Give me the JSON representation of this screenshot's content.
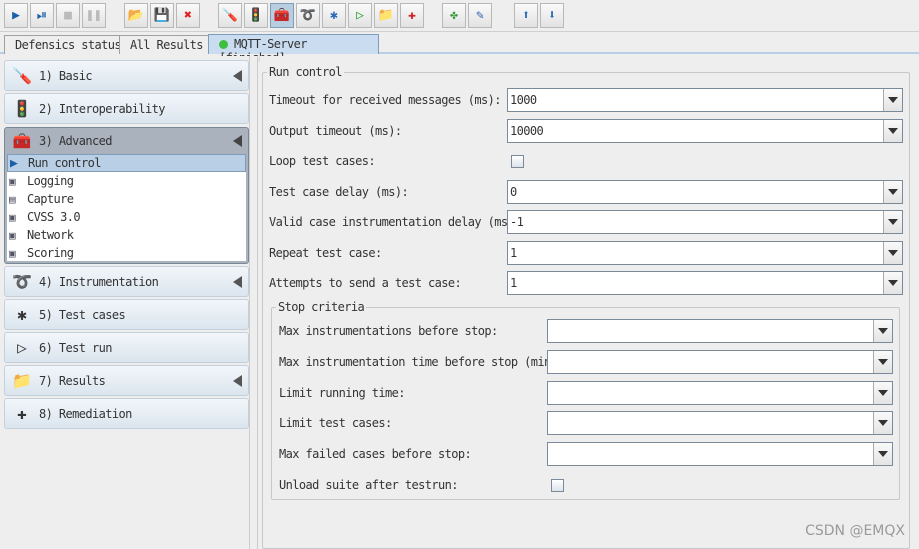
{
  "toolbar": {
    "buttons": [
      {
        "icon": "play-icon",
        "glyph": "▶",
        "color": "#1a5fa8"
      },
      {
        "icon": "play-step-icon",
        "glyph": "⏯",
        "color": "#1a5fa8"
      },
      {
        "icon": "stop-icon",
        "glyph": "■",
        "color": "#bbbbbb"
      },
      {
        "icon": "pause-icon",
        "glyph": "❚❚",
        "color": "#bbbbbb"
      },
      {
        "icon": "open-suite-icon",
        "glyph": "📂",
        "color": "#c44"
      },
      {
        "icon": "save-icon",
        "glyph": "💾",
        "color": "#2a5ea8"
      },
      {
        "icon": "close-icon",
        "glyph": "✖",
        "color": "#e02020"
      },
      {
        "icon": "screwdriver-icon",
        "glyph": "🪛",
        "color": "#c00"
      },
      {
        "icon": "traffic-light-icon",
        "glyph": "🚦",
        "color": "#3a3"
      },
      {
        "icon": "toolbox-icon",
        "glyph": "🧰",
        "color": "#556"
      },
      {
        "icon": "instrumentation-icon",
        "glyph": "➰",
        "color": "#666"
      },
      {
        "icon": "puzzle-icon",
        "glyph": "✱",
        "color": "#2a6ab8"
      },
      {
        "icon": "run-icon",
        "glyph": "▷",
        "color": "#2a9a2a"
      },
      {
        "icon": "folder-icon",
        "glyph": "📁",
        "color": "#d9a400"
      },
      {
        "icon": "first-aid-icon",
        "glyph": "✚",
        "color": "#d02020"
      },
      {
        "icon": "plugin-icon",
        "glyph": "✤",
        "color": "#3a9a3a"
      },
      {
        "icon": "edit-icon",
        "glyph": "✎",
        "color": "#2a5ea8"
      },
      {
        "icon": "arrow-up-icon",
        "glyph": "⬆",
        "color": "#2a6ab8"
      },
      {
        "icon": "arrow-down-icon",
        "glyph": "⬇",
        "color": "#2a6ab8"
      }
    ]
  },
  "tabs": [
    {
      "label": "Defensics status"
    },
    {
      "label": "All Results"
    },
    {
      "label": "MQTT-Server [finished]",
      "status_color": "#3fbf3f"
    }
  ],
  "sidebar": {
    "sections": [
      {
        "label": "1) Basic",
        "icon": "screwdriver-icon",
        "glyph": "🪛"
      },
      {
        "label": "2) Interoperability",
        "icon": "traffic-light-icon",
        "glyph": "🚦"
      },
      {
        "label": "3) Advanced",
        "icon": "toolbox-icon",
        "glyph": "🧰"
      },
      {
        "label": "4) Instrumentation",
        "icon": "instrumentation-icon",
        "glyph": "➰"
      },
      {
        "label": "5) Test cases",
        "icon": "puzzle-icon",
        "glyph": "✱"
      },
      {
        "label": "6) Test run",
        "icon": "run-icon",
        "glyph": "▷"
      },
      {
        "label": "7) Results",
        "icon": "folder-icon",
        "glyph": "📁"
      },
      {
        "label": "8) Remediation",
        "icon": "first-aid-icon",
        "glyph": "✚"
      }
    ],
    "advanced_items": [
      {
        "label": "Run control",
        "icon": "play-icon",
        "glyph": "▶"
      },
      {
        "label": "Logging",
        "icon": "toolbox-icon",
        "glyph": "▣"
      },
      {
        "label": "Capture",
        "icon": "network-card-icon",
        "glyph": "▤"
      },
      {
        "label": "CVSS 3.0",
        "icon": "toolbox-icon",
        "glyph": "▣"
      },
      {
        "label": "Network",
        "icon": "toolbox-icon",
        "glyph": "▣"
      },
      {
        "label": "Scoring",
        "icon": "toolbox-icon",
        "glyph": "▣"
      }
    ]
  },
  "run_control": {
    "title": "Run control",
    "fields": [
      {
        "label": "Timeout for received messages (ms):",
        "type": "combo",
        "value": "1000"
      },
      {
        "label": "Output timeout (ms):",
        "type": "combo",
        "value": "10000"
      },
      {
        "label": "Loop test cases:",
        "type": "checkbox",
        "checked": false
      },
      {
        "label": "Test case delay (ms):",
        "type": "combo",
        "value": "0"
      },
      {
        "label": "Valid case instrumentation delay (ms):",
        "type": "combo",
        "value": "-1"
      },
      {
        "label": "Repeat test case:",
        "type": "combo",
        "value": "1"
      },
      {
        "label": "Attempts to send a test case:",
        "type": "combo",
        "value": "1"
      }
    ]
  },
  "stop_criteria": {
    "title": "Stop criteria",
    "fields": [
      {
        "label": "Max instrumentations before stop:",
        "type": "combo",
        "value": ""
      },
      {
        "label": "Max instrumentation time before stop (min):",
        "type": "combo",
        "value": ""
      },
      {
        "label": "Limit running time:",
        "type": "combo",
        "value": ""
      },
      {
        "label": "Limit test cases:",
        "type": "combo",
        "value": ""
      },
      {
        "label": "Max failed cases before stop:",
        "type": "combo",
        "value": ""
      },
      {
        "label": "Unload suite after testrun:",
        "type": "checkbox",
        "checked": false
      }
    ]
  },
  "watermark": "CSDN @EMQX"
}
